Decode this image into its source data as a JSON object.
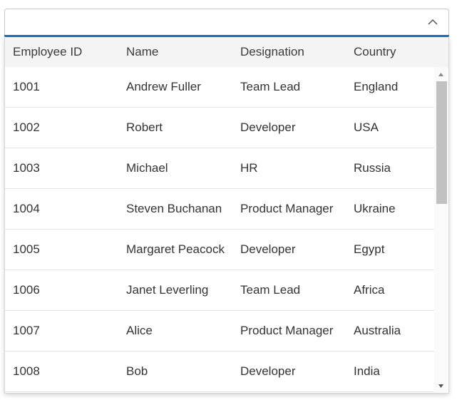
{
  "combobox": {
    "value": "",
    "toggle_icon": "chevron-up-icon"
  },
  "grid": {
    "columns": [
      "Employee ID",
      "Name",
      "Designation",
      "Country"
    ],
    "rows": [
      [
        "1001",
        "Andrew Fuller",
        "Team Lead",
        "England"
      ],
      [
        "1002",
        "Robert",
        "Developer",
        "USA"
      ],
      [
        "1003",
        "Michael",
        "HR",
        "Russia"
      ],
      [
        "1004",
        "Steven Buchanan",
        "Product Manager",
        "Ukraine"
      ],
      [
        "1005",
        "Margaret Peacock",
        "Developer",
        "Egypt"
      ],
      [
        "1006",
        "Janet Leverling",
        "Team Lead",
        "Africa"
      ],
      [
        "1007",
        "Alice",
        "Product Manager",
        "Australia"
      ],
      [
        "1008",
        "Bob",
        "Developer",
        "India"
      ]
    ]
  },
  "scrollbar": {
    "up_icon": "arrow-up-icon",
    "down_icon": "arrow-down-icon"
  },
  "colors": {
    "accent": "#1a6fc4",
    "header_bg": "#f4f4f4",
    "text": "#333333"
  }
}
